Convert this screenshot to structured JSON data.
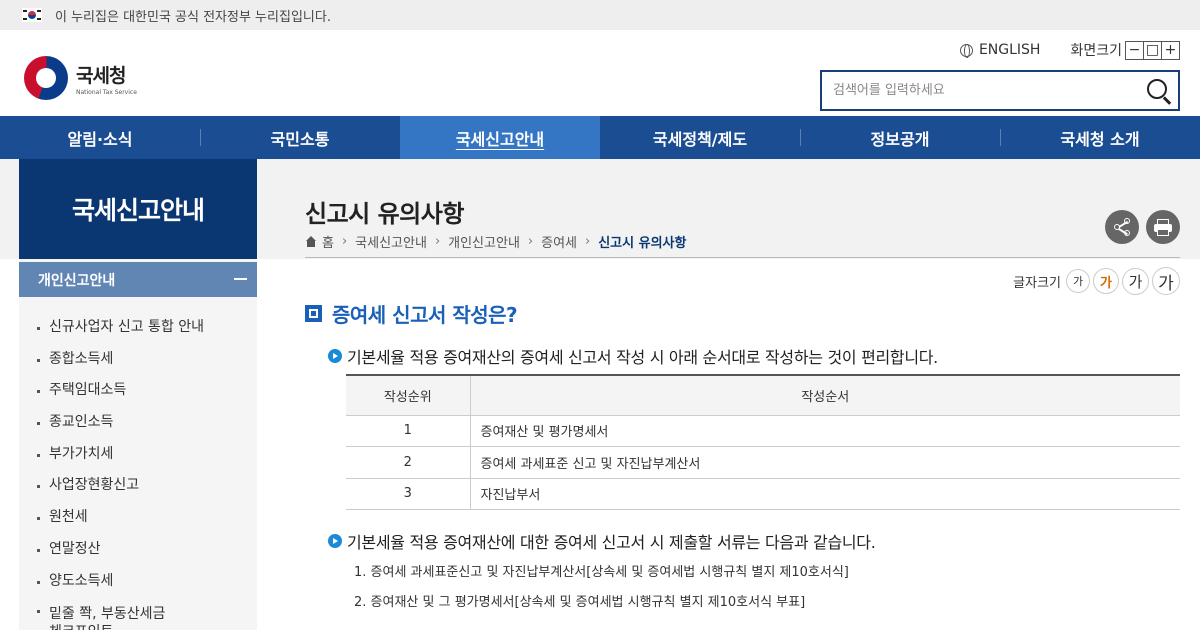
{
  "gov_banner": {
    "text": "이 누리집은 대한민국 공식 전자정부 누리집입니다."
  },
  "logo": {
    "name_ko": "국세청",
    "name_en": "National Tax Service"
  },
  "utility": {
    "english": "ENGLISH",
    "zoom_label": "화면크기",
    "zoom_out": "−",
    "zoom_reset": "□",
    "zoom_in": "+"
  },
  "search": {
    "placeholder": "검색어를 입력하세요"
  },
  "gnb": [
    {
      "label": "알림·소식"
    },
    {
      "label": "국민소통"
    },
    {
      "label": "국세신고안내"
    },
    {
      "label": "국세정책/제도"
    },
    {
      "label": "정보공개"
    },
    {
      "label": "국세청 소개"
    }
  ],
  "lnb": {
    "title": "국세신고안내",
    "sub": "개인신고안내",
    "items": [
      "신규사업자 신고 통합 안내",
      "종합소득세",
      "주택임대소득",
      "종교인소득",
      "부가가치세",
      "사업장현황신고",
      "원천세",
      "연말정산",
      "양도소득세",
      "밑줄 쫙, 부동산세금 체크포인트"
    ]
  },
  "page": {
    "title": "신고시 유의사항",
    "breadcrumb": [
      "홈",
      "국세신고안내",
      "개인신고안내",
      "증여세",
      "신고시 유의사항"
    ],
    "fontsize_label": "글자크기",
    "fontsize_buttons": [
      "가",
      "가",
      "가",
      "가"
    ]
  },
  "section": {
    "heading": "증여세 신고서 작성은?",
    "bullet1": "기본세율 적용 증여재산의 증여세 신고서 작성 시 아래 순서대로 작성하는 것이 편리합니다.",
    "table": {
      "headers": [
        "작성순위",
        "작성순서"
      ],
      "rows": [
        [
          "1",
          "증여재산 및 평가명세서"
        ],
        [
          "2",
          "증여세 과세표준 신고 및 자진납부계산서"
        ],
        [
          "3",
          "자진납부서"
        ]
      ]
    },
    "bullet2": "기본세율 적용 증여재산에 대한 증여세 신고서 시 제출할 서류는 다음과 같습니다.",
    "docs": [
      "1. 증여세 과세표준신고 및 자진납부계산서[상속세 및 증여세법 시행규칙 별지 제10호서식]",
      "2. 증여재산 및 그 평가명세서[상속세 및 증여세법 시행규칙 별지 제10호서식 부표]"
    ]
  },
  "colors": {
    "nav": "#1b4d93",
    "nav_active": "#3576c4",
    "lnb_title": "#0a3772",
    "accent": "#1b60b8"
  }
}
